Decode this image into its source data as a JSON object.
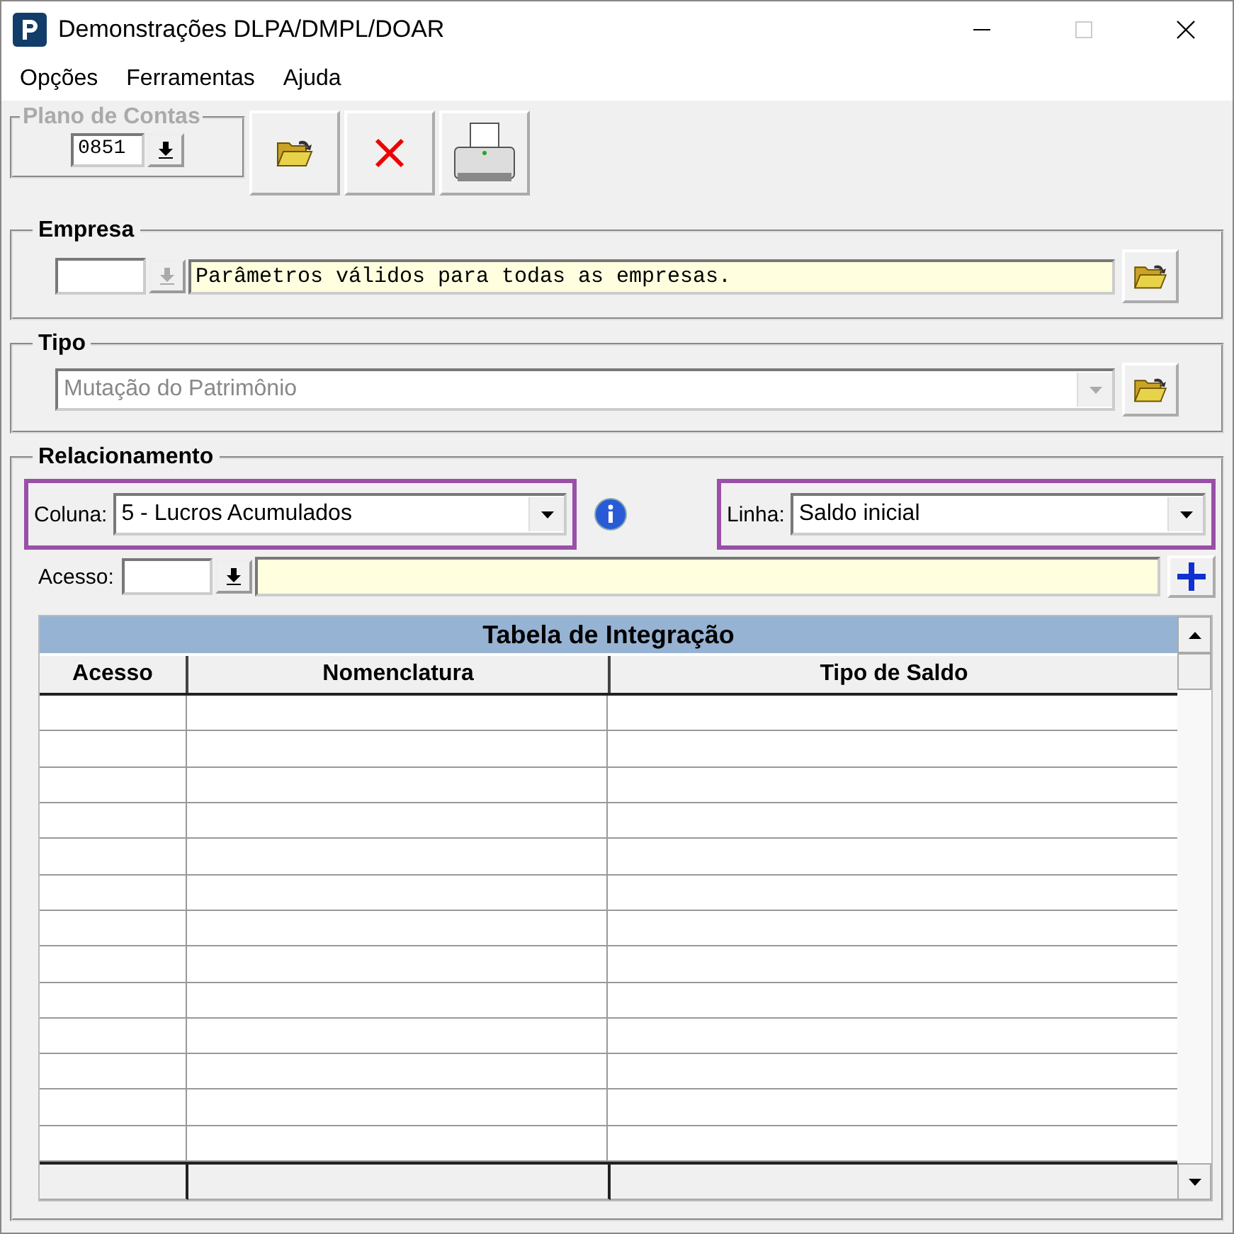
{
  "window": {
    "title": "Demonstrações DLPA/DMPL/DOAR"
  },
  "menu": [
    "Opções",
    "Ferramentas",
    "Ajuda"
  ],
  "plano_de_contas": {
    "label": "Plano de Contas",
    "disabled": true,
    "value": "0851"
  },
  "empresa": {
    "label": "Empresa",
    "description": "Parâmetros válidos para todas as empresas."
  },
  "tipo": {
    "label": "Tipo",
    "value": "Mutação do Patrimônio",
    "disabled": true
  },
  "relacionamento": {
    "label": "Relacionamento",
    "coluna": {
      "label": "Coluna:",
      "value": "5 - Lucros Acumulados"
    },
    "linha": {
      "label": "Linha:",
      "value": "Saldo inicial"
    },
    "acesso": {
      "label": "Acesso:"
    }
  },
  "table": {
    "title": "Tabela de Integração",
    "columns": [
      "Acesso",
      "Nomenclatura",
      "Tipo de Saldo"
    ]
  }
}
